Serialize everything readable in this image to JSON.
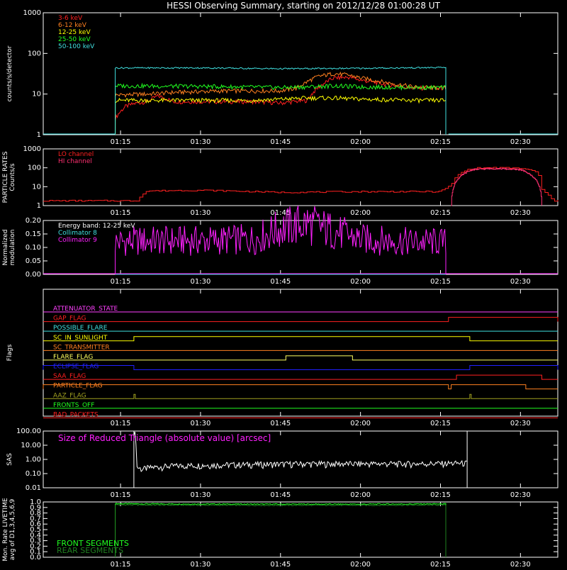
{
  "title": "HESSI Observing Summary, starting on 2012/12/28 01:00:28 UT",
  "x_ticks": [
    "01:15",
    "01:30",
    "01:45",
    "02:00",
    "02:15",
    "02:30"
  ],
  "x_tick_minutes": [
    15,
    30,
    45,
    60,
    75,
    90
  ],
  "x_range_minutes": [
    0.5,
    97
  ],
  "data_window_minutes": [
    14,
    76.5
  ],
  "colors": {
    "bg": "#000000",
    "axis": "#ffffff"
  },
  "chart_data": [
    {
      "id": "count-rates",
      "type": "line",
      "ylabel": "counts/s/detector",
      "yscale": "log",
      "ylim": [
        1,
        1000
      ],
      "y_ticks": [
        "1",
        "10",
        "100",
        "1000"
      ],
      "y_tick_values": [
        1,
        10,
        100,
        1000
      ],
      "legend": "top-left",
      "series": [
        {
          "name": "3-6 keV",
          "color": "#ff2020",
          "x": [
            14,
            16,
            18,
            20,
            22,
            25,
            30,
            35,
            40,
            45,
            50,
            52,
            55,
            58,
            60,
            65,
            70,
            76
          ],
          "values": [
            2.5,
            5,
            6,
            6.5,
            9,
            6.5,
            6.5,
            6.5,
            6.5,
            6,
            7,
            14,
            25,
            26,
            22,
            17,
            14,
            14
          ]
        },
        {
          "name": "6-12 keV",
          "color": "#ff8020",
          "x": [
            14,
            20,
            25,
            30,
            35,
            40,
            45,
            48,
            50,
            52,
            55,
            58,
            60,
            65,
            70,
            76
          ],
          "values": [
            9.5,
            10,
            11,
            11.5,
            12,
            12,
            12,
            14,
            20,
            27,
            32,
            29,
            25,
            19,
            15,
            14
          ]
        },
        {
          "name": "12-25 keV",
          "color": "#ffff00",
          "x": [
            14,
            20,
            30,
            40,
            45,
            50,
            55,
            60,
            70,
            76
          ],
          "values": [
            7,
            7,
            7,
            7,
            7.5,
            8,
            8,
            7.5,
            7,
            7
          ]
        },
        {
          "name": "25-50 keV",
          "color": "#20ff20",
          "x": [
            14,
            30,
            45,
            50,
            55,
            60,
            70,
            76
          ],
          "values": [
            16,
            15.5,
            14.5,
            15,
            16,
            15,
            14.5,
            14.5
          ]
        },
        {
          "name": "50-100 keV",
          "color": "#40e0e0",
          "x": [
            14,
            30,
            45,
            60,
            76
          ],
          "values": [
            44,
            44,
            42,
            43,
            45
          ]
        }
      ]
    },
    {
      "id": "particle-rates",
      "type": "line",
      "ylabel": "PARTICLE RATES Counts/s",
      "yscale": "log",
      "ylim": [
        1,
        1000
      ],
      "y_ticks": [
        "1",
        "10",
        "100",
        "1000"
      ],
      "y_tick_values": [
        1,
        10,
        100,
        1000
      ],
      "legend": "top-left",
      "series": [
        {
          "name": "LO channel",
          "color": "#ff2020",
          "x": [
            0.5,
            18,
            20,
            30,
            45,
            60,
            75,
            77,
            79,
            81,
            84,
            86,
            90,
            93,
            94,
            96,
            97
          ],
          "values": [
            1.8,
            1.8,
            6,
            6.5,
            5,
            5.5,
            5.5,
            12,
            60,
            95,
            100,
            100,
            95,
            60,
            6,
            1.8,
            1.8
          ]
        },
        {
          "name": "HI channel",
          "color": "#ff3070",
          "x": [
            77,
            79,
            81,
            84,
            86,
            90,
            92,
            94
          ],
          "values": [
            1,
            40,
            80,
            90,
            90,
            80,
            40,
            1
          ]
        }
      ]
    },
    {
      "id": "modulation",
      "type": "line",
      "ylabel": "Normalized modulation",
      "ylim": [
        0,
        0.2
      ],
      "y_ticks": [
        "0.00",
        "0.05",
        "0.10",
        "0.15",
        "0.20"
      ],
      "y_tick_values": [
        0,
        0.05,
        0.1,
        0.15,
        0.2
      ],
      "legend": "top-left",
      "annotation": "Energy band: 12-25 keV",
      "series": [
        {
          "name": "Collimator 8",
          "color": "#40e0e0",
          "x": [
            14,
            76
          ],
          "values": [
            0,
            0
          ]
        },
        {
          "name": "Collimator 9",
          "color": "#ff20ff",
          "x": [
            14,
            20,
            30,
            40,
            45,
            50,
            55,
            60,
            65,
            70,
            76
          ],
          "values": [
            0.12,
            0.125,
            0.125,
            0.13,
            0.17,
            0.19,
            0.16,
            0.13,
            0.125,
            0.12,
            0.12
          ]
        }
      ]
    },
    {
      "id": "flags",
      "type": "line",
      "ylabel": "Flags",
      "series": [
        {
          "name": "ATTENUATOR_STATE",
          "color": "#ff40ff",
          "steps": []
        },
        {
          "name": "GAP_FLAG",
          "color": "#ff2020",
          "steps": [
            [
              76.5,
              97
            ]
          ]
        },
        {
          "name": "POSSIBLE_FLARE",
          "color": "#40e0e0",
          "steps": []
        },
        {
          "name": "SC_IN_SUNLIGHT",
          "color": "#ffff00",
          "steps": [
            [
              17.5,
              80.5
            ]
          ]
        },
        {
          "name": "SC_TRANSMITTER",
          "color": "#ff8020",
          "steps": []
        },
        {
          "name": "FLARE_FLAG",
          "color": "#ffff60",
          "steps": [
            [
              46,
              58.5
            ]
          ]
        },
        {
          "name": "ECLIPSE_FLAG",
          "color": "#2020ff",
          "steps": [
            [
              0.5,
              17.5
            ],
            [
              80.5,
              97
            ]
          ]
        },
        {
          "name": "SAA_FLAG",
          "color": "#ff2020",
          "steps": [
            [
              78,
              94
            ]
          ]
        },
        {
          "name": "PARTICLE_FLAG",
          "color": "#ff8020",
          "steps": [
            [
              0.5,
              76.5
            ],
            [
              77,
              91
            ]
          ]
        },
        {
          "name": "AAZ_FLAG",
          "color": "#a0a020",
          "spikes": [
            17.5,
            80.5
          ]
        },
        {
          "name": "FRONTS_OFF",
          "color": "#20ff20",
          "steps": []
        },
        {
          "name": "BAD_PACKETS",
          "color": "#ff2020",
          "steps": []
        }
      ]
    },
    {
      "id": "sas",
      "type": "line",
      "ylabel": "SAS",
      "yscale": "log",
      "ylim": [
        0.01,
        100
      ],
      "y_ticks": [
        "0.01",
        "0.10",
        "1.00",
        "10.00",
        "100.00"
      ],
      "y_tick_values": [
        0.01,
        0.1,
        1,
        10,
        100
      ],
      "annotation": "Size of Reduced Triangle (absolute value) [arcsec]",
      "series": [
        {
          "name": "",
          "color": "#ffffff",
          "x": [
            17.5,
            18,
            19,
            20,
            22,
            25,
            30,
            40,
            50,
            60,
            70,
            80
          ],
          "values": [
            100,
            0.3,
            0.2,
            0.25,
            0.3,
            0.35,
            0.4,
            0.45,
            0.5,
            0.5,
            0.5,
            0.55
          ]
        }
      ]
    },
    {
      "id": "livetime",
      "type": "line",
      "ylabel": "Mon. Rate LIVETIME avg of D1,3,4,5,6,9",
      "ylim": [
        0,
        1
      ],
      "y_ticks": [
        "0.0",
        "0.1",
        "0.2",
        "0.3",
        "0.4",
        "0.5",
        "0.6",
        "0.7",
        "0.8",
        "0.9",
        "1.0"
      ],
      "y_tick_values": [
        0,
        0.1,
        0.2,
        0.3,
        0.4,
        0.5,
        0.6,
        0.7,
        0.8,
        0.9,
        1.0
      ],
      "legend": "bottom-left",
      "series": [
        {
          "name": "FRONT SEGMENTS",
          "color": "#20ff20",
          "x": [
            14,
            20,
            40,
            60,
            76
          ],
          "values": [
            0.97,
            0.965,
            0.96,
            0.96,
            0.965
          ]
        },
        {
          "name": "REAR SEGMENTS",
          "color": "#208020",
          "x": [
            14,
            20,
            40,
            60,
            76
          ],
          "values": [
            0.95,
            0.945,
            0.94,
            0.94,
            0.945
          ]
        }
      ]
    }
  ]
}
